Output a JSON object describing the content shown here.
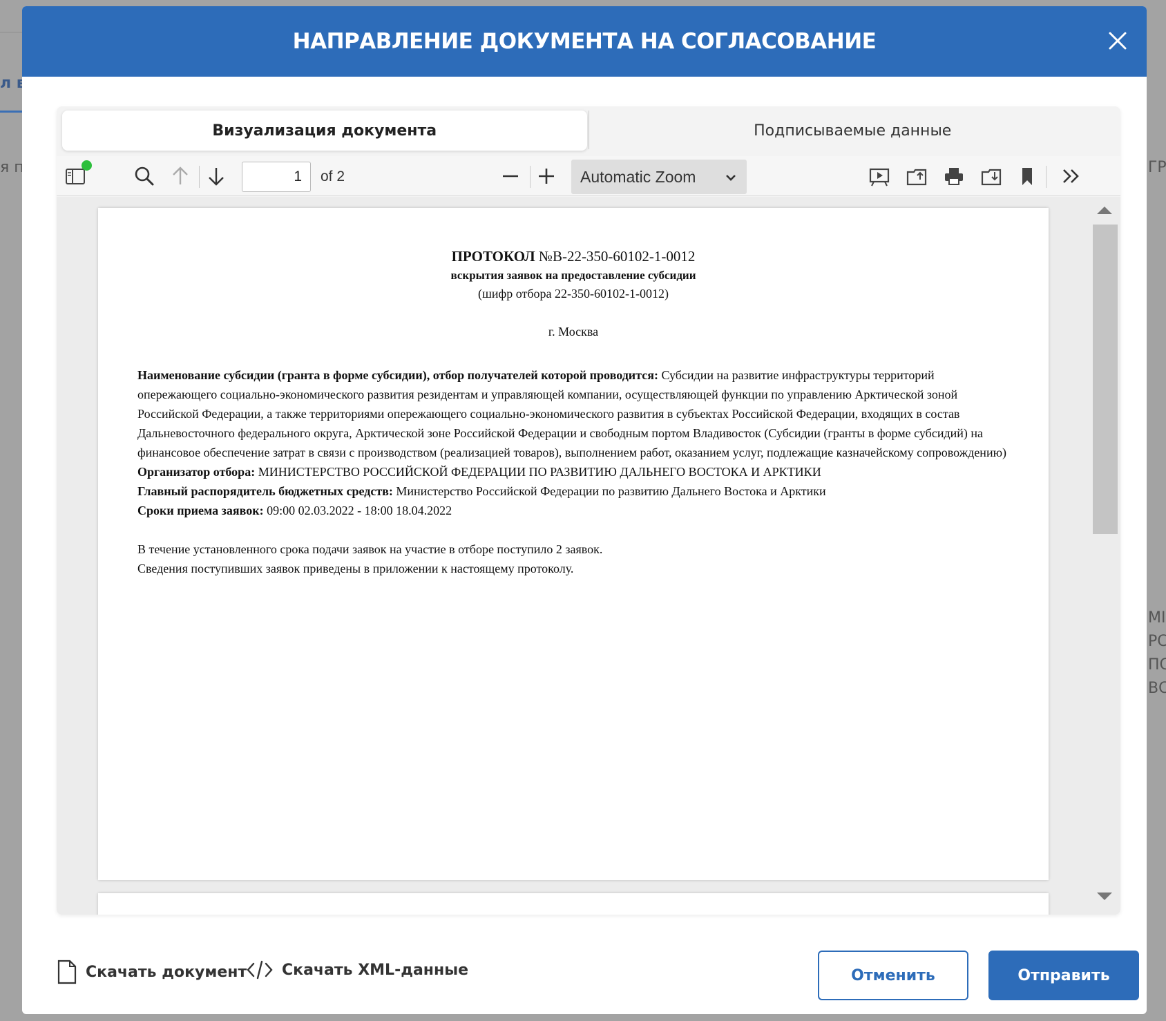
{
  "background": {
    "fragments": [
      "л вс",
      "я по",
      "ГР",
      "МІ",
      "РС",
      "ПС",
      "ВС"
    ]
  },
  "modal": {
    "title": "НАПРАВЛЕНИЕ ДОКУМЕНТА НА СОГЛАСОВАНИЕ",
    "close_icon": "close-icon"
  },
  "tabs": [
    {
      "label": "Визуализация документа",
      "active": true
    },
    {
      "label": "Подписываемые данные",
      "active": false
    }
  ],
  "toolbar": {
    "page_number": "1",
    "page_of": "of 2",
    "zoom": "Automatic Zoom",
    "icons": [
      "sidebar-toggle-icon",
      "search-icon",
      "arrow-up-icon",
      "arrow-down-icon",
      "zoom-out-icon",
      "zoom-in-icon",
      "presentation-icon",
      "open-file-icon",
      "print-icon",
      "download-icon",
      "bookmark-icon",
      "more-tools-icon"
    ]
  },
  "document": {
    "title_bold": "ПРОТОКОЛ",
    "title_number": "№В-22-350-60102-1-0012",
    "subtitle": "вскрытия заявок на предоставление субсидии",
    "cipher": "(шифр отбора 22-350-60102-1-0012)",
    "city": "г. Москва",
    "subsidy_label": "Наименование субсидии (гранта в форме субсидии), отбор получателей которой проводится:",
    "subsidy_text": "Субсидии на развитие инфраструктуры территорий опережающего социально-экономического развития резидентам и управляющей компании, осуществляющей функции по управлению Арктической зоной Российской Федерации, а также территориями опережающего социально-экономического развития в субъектах Российской Федерации, входящих в состав Дальневосточного федерального округа, Арктической зоне Российской Федерации и свободным портом Владивосток (Субсидии (гранты в форме субсидий) на финансовое обеспечение затрат в связи с производством (реализацией товаров), выполнением работ, оказанием услуг, подлежащие казначейскому сопровождению)",
    "organizer_label": "Организатор отбора:",
    "organizer_text": "МИНИСТЕРСТВО РОССИЙСКОЙ ФЕДЕРАЦИИ ПО РАЗВИТИЮ ДАЛЬНЕГО ВОСТОКА И АРКТИКИ",
    "manager_label": "Главный распорядитель бюджетных средств:",
    "manager_text": "Министерство Российской Федерации по развитию Дальнего Востока и Арктики",
    "deadline_label": "Сроки приема заявок:",
    "deadline_text": "09:00 02.03.2022 - 18:00 18.04.2022",
    "line1": "В течение установленного срока подачи заявок на участие в отборе поступило 2 заявок.",
    "line2": "Сведения поступивших заявок приведены в приложении к настоящему протоколу."
  },
  "footer": {
    "download_doc": "Скачать документ",
    "download_xml": "Скачать XML-данные",
    "cancel": "Отменить",
    "send": "Отправить"
  },
  "colors": {
    "accent": "#2d6cb9",
    "status_dot": "#2dbf3c"
  }
}
